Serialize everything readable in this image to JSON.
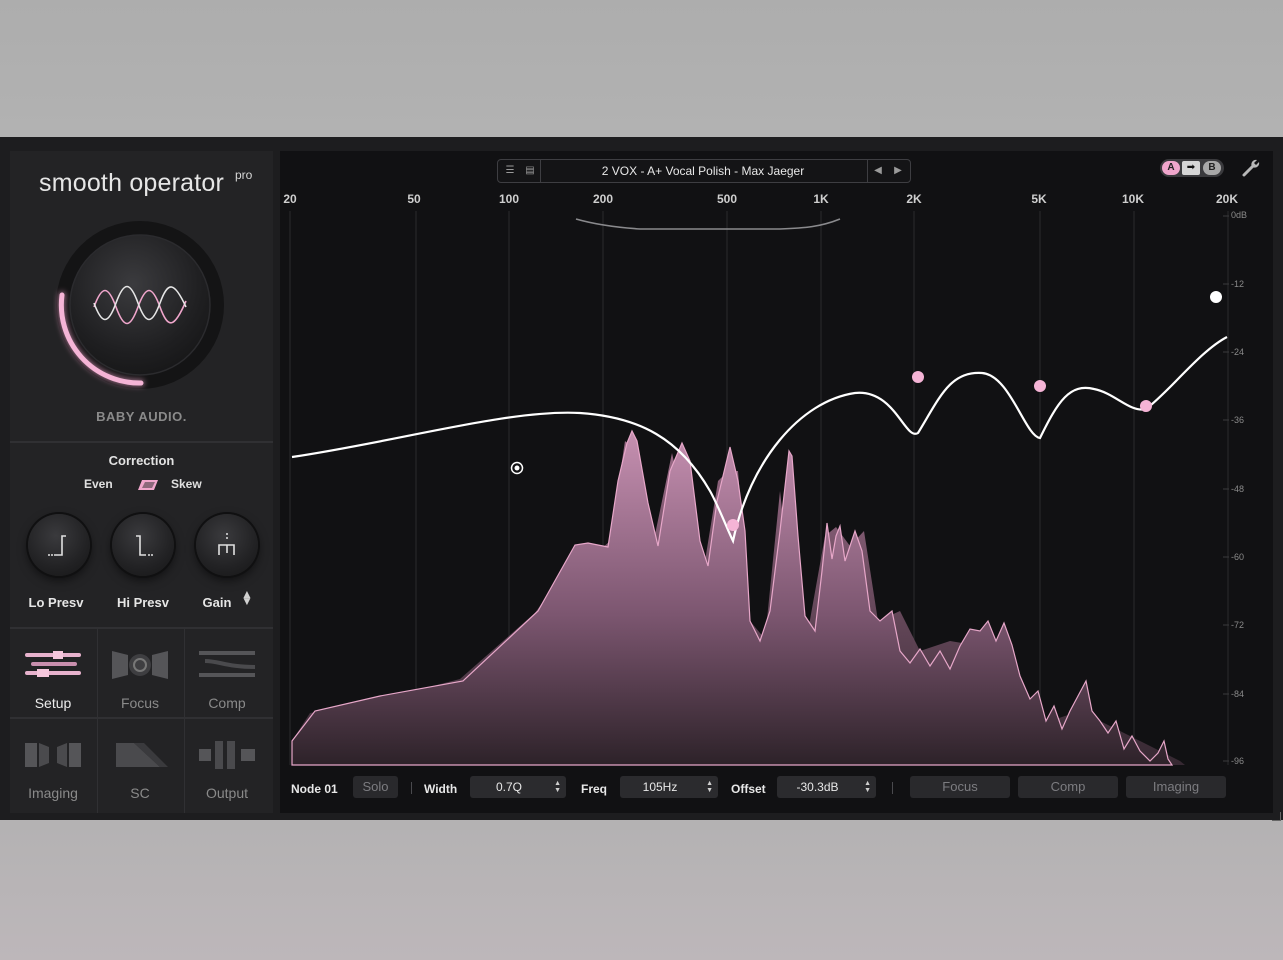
{
  "brand": {
    "title": "smooth operator",
    "edition": "pro",
    "company": "BABY AUDIO."
  },
  "correction": {
    "title": "Correction",
    "left_label": "Even",
    "right_label": "Skew"
  },
  "knobs": [
    {
      "label": "Lo Presv",
      "icon": "lo-presv-icon"
    },
    {
      "label": "Hi Presv",
      "icon": "hi-presv-icon"
    },
    {
      "label": "Gain",
      "icon": "gain-icon"
    }
  ],
  "nav": [
    {
      "label": "Setup",
      "icon": "setup-icon",
      "active": true
    },
    {
      "label": "Focus",
      "icon": "focus-icon",
      "active": false
    },
    {
      "label": "Comp",
      "icon": "comp-icon",
      "active": false
    },
    {
      "label": "Imaging",
      "icon": "imaging-icon",
      "active": false
    },
    {
      "label": "SC",
      "icon": "sc-icon",
      "active": false
    },
    {
      "label": "Output",
      "icon": "output-icon",
      "active": false
    }
  ],
  "preset": {
    "name": "2 VOX - A+ Vocal Polish - Max Jaeger",
    "menu_icon": "menu-icon",
    "save_icon": "save-icon",
    "prev_icon": "prev-icon",
    "next_icon": "next-icon"
  },
  "ab": {
    "a": "A",
    "copy": "➡",
    "b": "B"
  },
  "freq_labels": [
    "20",
    "50",
    "100",
    "200",
    "500",
    "1K",
    "2K",
    "5K",
    "10K",
    "20K"
  ],
  "db_labels": [
    "0dB",
    "-12",
    "-24",
    "-36",
    "-48",
    "-60",
    "-72",
    "-84",
    "-96"
  ],
  "node_bar": {
    "node": "Node 01",
    "solo": "Solo",
    "width_label": "Width",
    "width_value": "0.7Q",
    "freq_label": "Freq",
    "freq_value": "105Hz",
    "offset_label": "Offset",
    "offset_value": "-30.3dB",
    "buttons": [
      "Focus",
      "Comp",
      "Imaging"
    ]
  },
  "colors": {
    "accent": "#f0a6cc",
    "background": "#1d1d1f",
    "graph": "#111113",
    "spectrum": "#b27f9d"
  }
}
